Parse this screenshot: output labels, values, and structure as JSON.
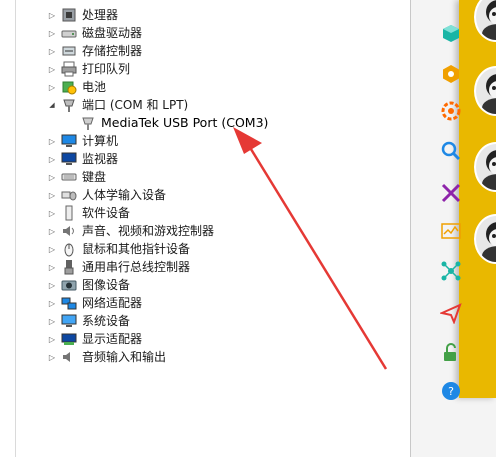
{
  "device_manager": {
    "categories": [
      {
        "label": "处理器",
        "icon": "processor-icon",
        "expanded": false
      },
      {
        "label": "磁盘驱动器",
        "icon": "disk-drive-icon",
        "expanded": false
      },
      {
        "label": "存储控制器",
        "icon": "storage-controller-icon",
        "expanded": false
      },
      {
        "label": "打印队列",
        "icon": "printer-icon",
        "expanded": false
      },
      {
        "label": "电池",
        "icon": "battery-icon",
        "expanded": false
      },
      {
        "label": "端口 (COM 和 LPT)",
        "icon": "port-icon",
        "expanded": true
      },
      {
        "label": "计算机",
        "icon": "computer-icon",
        "expanded": false
      },
      {
        "label": "监视器",
        "icon": "monitor-icon",
        "expanded": false
      },
      {
        "label": "键盘",
        "icon": "keyboard-icon",
        "expanded": false
      },
      {
        "label": "人体学输入设备",
        "icon": "hid-icon",
        "expanded": false
      },
      {
        "label": "软件设备",
        "icon": "software-device-icon",
        "expanded": false
      },
      {
        "label": "声音、视频和游戏控制器",
        "icon": "speaker-icon",
        "expanded": false
      },
      {
        "label": "鼠标和其他指针设备",
        "icon": "mouse-icon",
        "expanded": false
      },
      {
        "label": "通用串行总线控制器",
        "icon": "usb-icon",
        "expanded": false
      },
      {
        "label": "图像设备",
        "icon": "camera-icon",
        "expanded": false
      },
      {
        "label": "网络适配器",
        "icon": "network-adapter-icon",
        "expanded": false
      },
      {
        "label": "系统设备",
        "icon": "system-device-icon",
        "expanded": false
      },
      {
        "label": "显示适配器",
        "icon": "display-adapter-icon",
        "expanded": false
      },
      {
        "label": "音频输入和输出",
        "icon": "audio-io-icon",
        "expanded": false
      }
    ],
    "port_child": {
      "label": "MediaTek USB Port (COM3)",
      "icon": "serial-port-icon"
    }
  },
  "annotation": {
    "arrow_color": "#e53935"
  },
  "toolbar": {
    "background": "#e9b800",
    "tools": [
      {
        "icon": "cube-icon",
        "color": "#19b5a5"
      },
      {
        "icon": "hexagon-icon",
        "color": "#f0a000"
      },
      {
        "icon": "gear-icon",
        "color": "#ff6a00"
      },
      {
        "icon": "magnifier-icon",
        "color": "#1e88e5"
      },
      {
        "icon": "tools-icon",
        "color": "#8e24aa"
      },
      {
        "icon": "chart-icon",
        "color": "#f0a000"
      },
      {
        "icon": "network-icon",
        "color": "#19b5a5"
      },
      {
        "icon": "send-icon",
        "color": "#e53935"
      },
      {
        "icon": "unlock-icon",
        "color": "#43a047"
      },
      {
        "icon": "help-icon",
        "color": "#1e88e5"
      }
    ]
  }
}
